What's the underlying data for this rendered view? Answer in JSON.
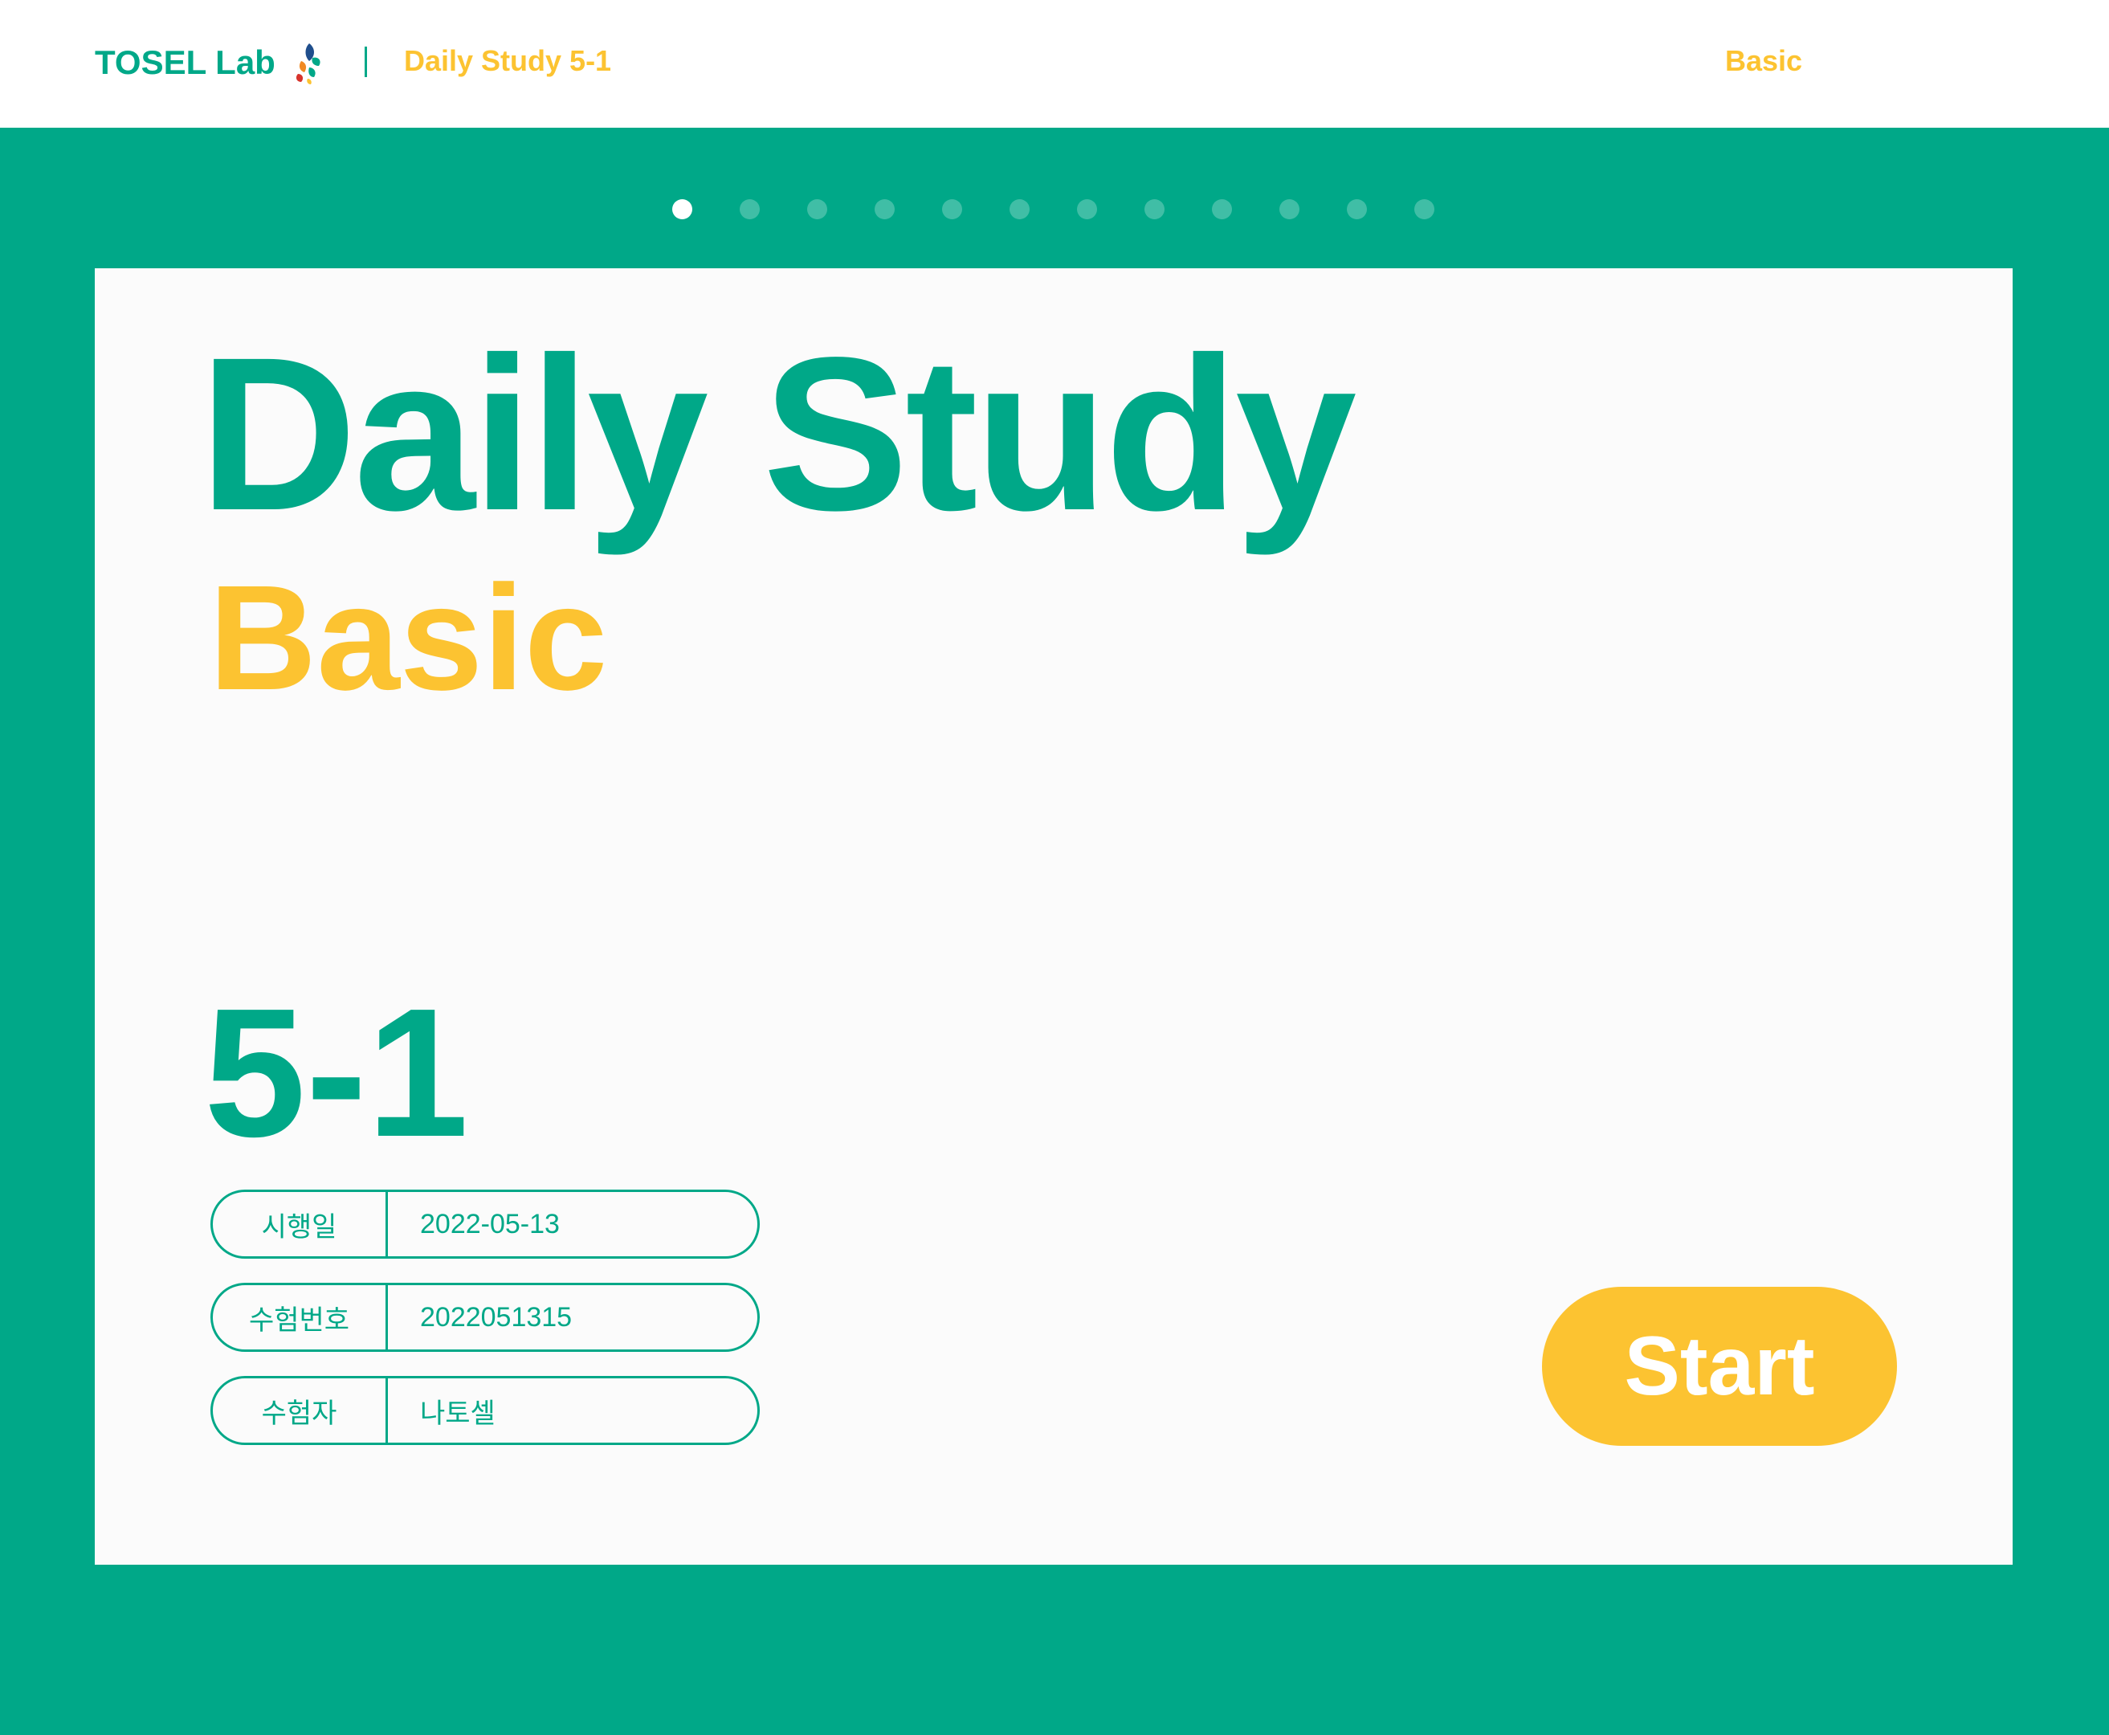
{
  "header": {
    "brand": "TOSEL Lab",
    "breadcrumb": "Daily Study 5-1",
    "level_link": "Basic"
  },
  "pagination": {
    "total": 12,
    "current": 1
  },
  "card": {
    "title": "Daily Study",
    "level": "Basic",
    "number": "5-1",
    "info": [
      {
        "label": "시행일",
        "value": "2022-05-13"
      },
      {
        "label": "수험번호",
        "value": "2022051315"
      },
      {
        "label": "수험자",
        "value": "나토셀"
      }
    ],
    "start_label": "Start"
  },
  "colors": {
    "primary": "#00a888",
    "accent": "#fcc331",
    "card_bg": "#fbfbfb"
  },
  "icons": {
    "brand_logo": "leaf-logo-icon"
  }
}
